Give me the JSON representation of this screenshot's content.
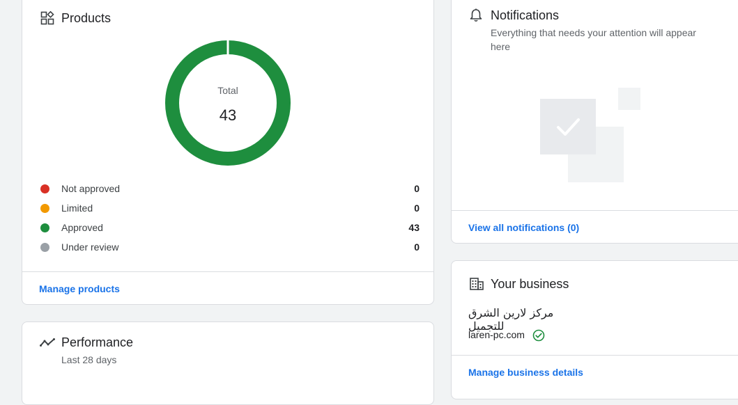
{
  "products": {
    "title": "Products",
    "icon": "category-icon",
    "donut": {
      "label": "Total",
      "value": "43"
    },
    "legend": [
      {
        "label": "Not approved",
        "value": "0",
        "color": "#d93025"
      },
      {
        "label": "Limited",
        "value": "0",
        "color": "#f29900"
      },
      {
        "label": "Approved",
        "value": "43",
        "color": "#1e8e3e"
      },
      {
        "label": "Under review",
        "value": "0",
        "color": "#9aa0a6"
      }
    ],
    "manage_link": "Manage products"
  },
  "performance": {
    "title": "Performance",
    "icon": "trending-icon",
    "subtitle": "Last 28 days"
  },
  "notifications": {
    "title": "Notifications",
    "icon": "bell-icon",
    "subtitle": "Everything that needs your attention will appear here",
    "view_all": "View all notifications (0)"
  },
  "business": {
    "title": "Your business",
    "icon": "building-icon",
    "name": "مركز لارين الشرق للتجميل",
    "website": "laren-pc.com",
    "verified_icon": "check-circle-icon",
    "manage_link": "Manage business details"
  },
  "colors": {
    "accent": "#1a73e8",
    "approved": "#1e8e3e"
  }
}
